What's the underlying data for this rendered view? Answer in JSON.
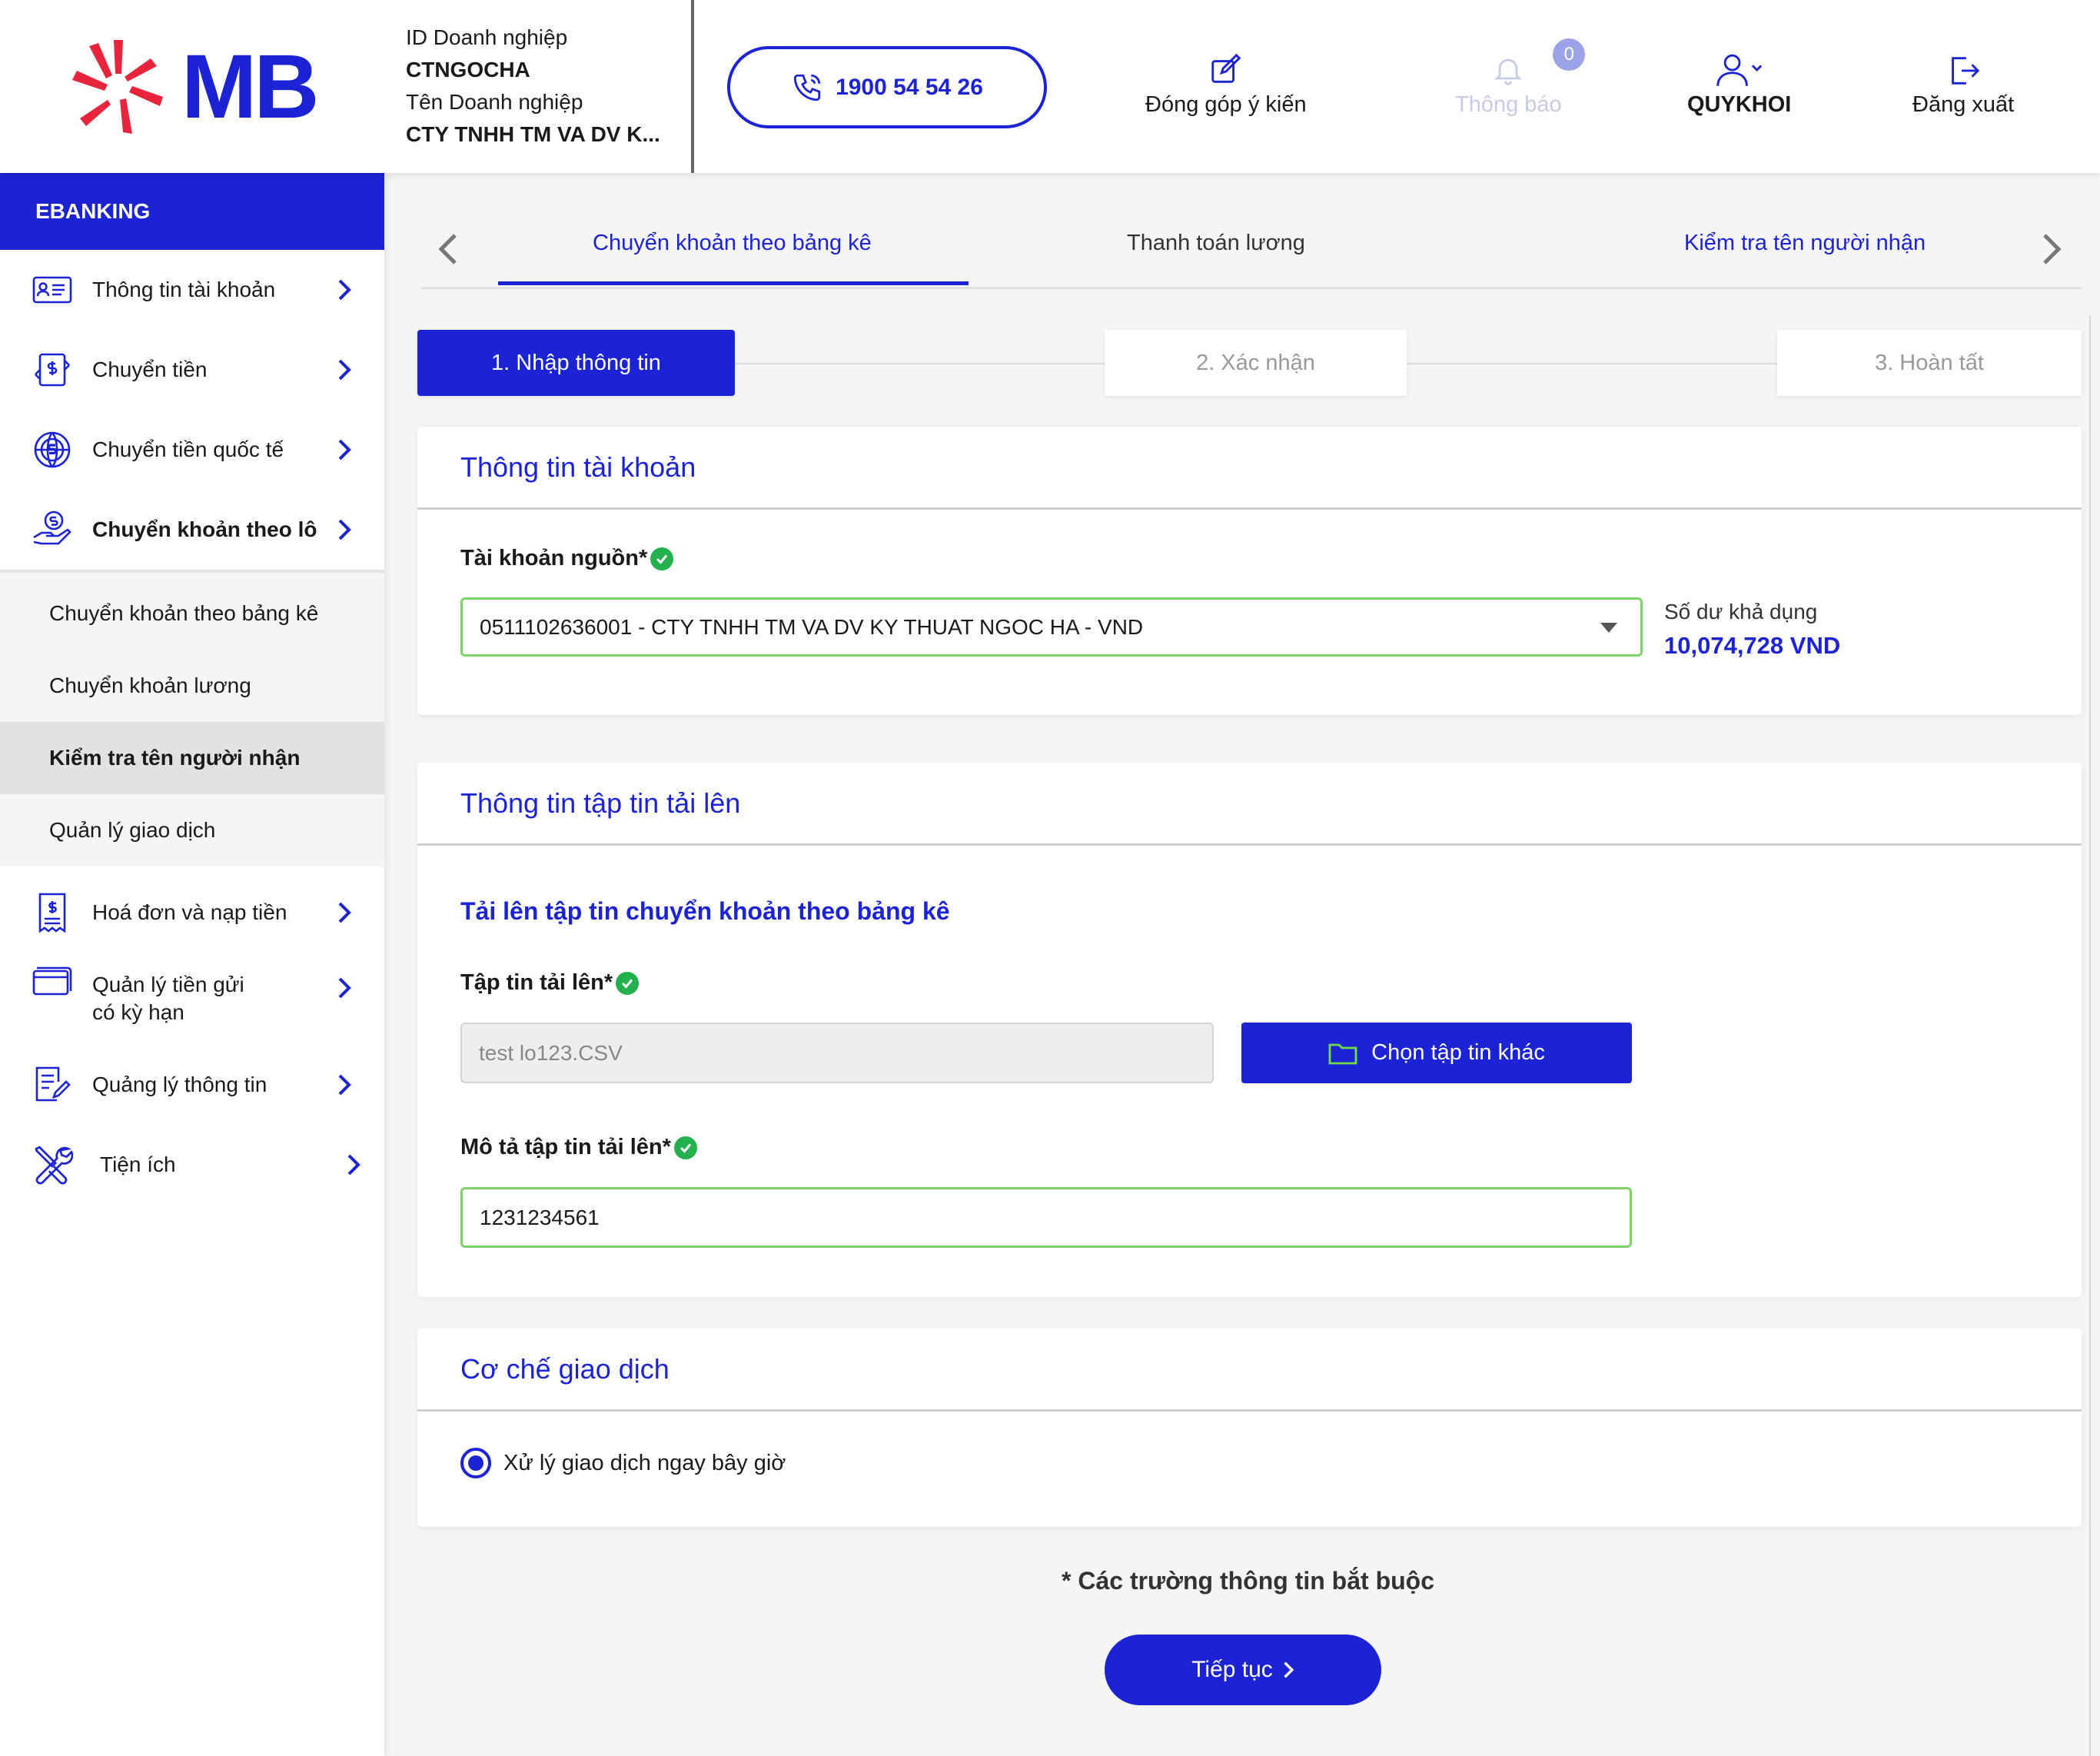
{
  "header": {
    "logo_text": "MB",
    "company": {
      "id_label": "ID Doanh nghiệp",
      "id_value": "CTNGOCHA",
      "name_label": "Tên Doanh nghiệp",
      "name_value": "CTY TNHH TM VA DV K..."
    },
    "hotline": "1900 54 54 26",
    "feedback_label": "Đóng góp ý kiến",
    "notifications_label": "Thông báo",
    "notifications_count": "0",
    "user_name": "QUYKHOI",
    "logout_label": "Đăng xuất"
  },
  "sidebar": {
    "title": "EBANKING",
    "items": [
      {
        "label": "Thông tin tài khoản"
      },
      {
        "label": "Chuyển tiền"
      },
      {
        "label": "Chuyển tiền quốc tế"
      },
      {
        "label": "Chuyển khoản theo lô"
      }
    ],
    "submenu": [
      {
        "label": "Chuyển khoản theo bảng kê"
      },
      {
        "label": "Chuyển khoản lương"
      },
      {
        "label": "Kiểm tra tên người nhận"
      },
      {
        "label": "Quản lý giao dịch"
      }
    ],
    "items2": [
      {
        "label": "Hoá đơn và nạp tiền"
      },
      {
        "label_line1": "Quản lý tiền gửi",
        "label_line2": "có kỳ hạn"
      },
      {
        "label": "Quảng lý thông tin"
      },
      {
        "label": "Tiện ích"
      }
    ]
  },
  "tabs": [
    "Chuyển khoản theo bảng kê",
    "Thanh toán lương",
    "Kiểm tra tên người nhận"
  ],
  "steps": [
    "1.  Nhập thông tin",
    "2.  Xác nhận",
    "3.  Hoàn tất"
  ],
  "account_card": {
    "title": "Thông tin tài khoản",
    "source_label": "Tài khoản nguồn*",
    "source_value": "0511102636001 - CTY TNHH TM VA DV KY THUAT NGOC HA - VND",
    "balance_label": "Số dư khả dụng",
    "balance_value": "10,074,728 VND"
  },
  "file_card": {
    "title": "Thông tin tập tin tải lên",
    "subtitle": "Tải lên tập tin chuyển khoản theo bảng kê",
    "file_label": "Tập tin tải lên*",
    "file_value": "test lo123.CSV",
    "choose_button": "Chọn tập tin khác",
    "desc_label": "Mô tả tập tin tải lên*",
    "desc_value": "1231234561"
  },
  "mechanism_card": {
    "title": "Cơ chế giao dịch",
    "option": "Xử lý giao dịch ngay bây giờ"
  },
  "required_note": "* Các trường thông tin bắt buộc",
  "continue_button": "Tiếp tục",
  "colors": {
    "primary": "#1c23d4",
    "logo_red": "#e8243c",
    "valid_green": "#22b14c"
  }
}
